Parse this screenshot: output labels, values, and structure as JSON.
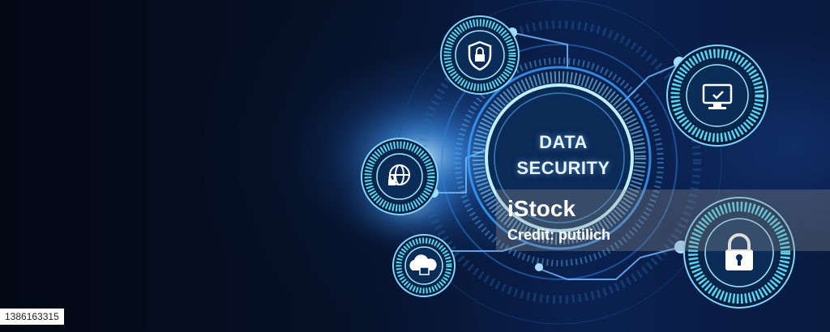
{
  "hero": {
    "title_line1": "DATA",
    "title_line2": "SECURITY"
  },
  "watermark": {
    "brand": "iStock",
    "credit": "Credit: putilich"
  },
  "image_id": "1386163315",
  "icons": [
    "shield-lock-icon",
    "monitor-check-icon",
    "globe-lock-icon",
    "cloud-lock-icon",
    "padlock-icon"
  ],
  "colors": {
    "background": "#040a18",
    "glow": "#2f7fe0",
    "accent": "#7fe3ff",
    "text": "#e9f3ff"
  }
}
